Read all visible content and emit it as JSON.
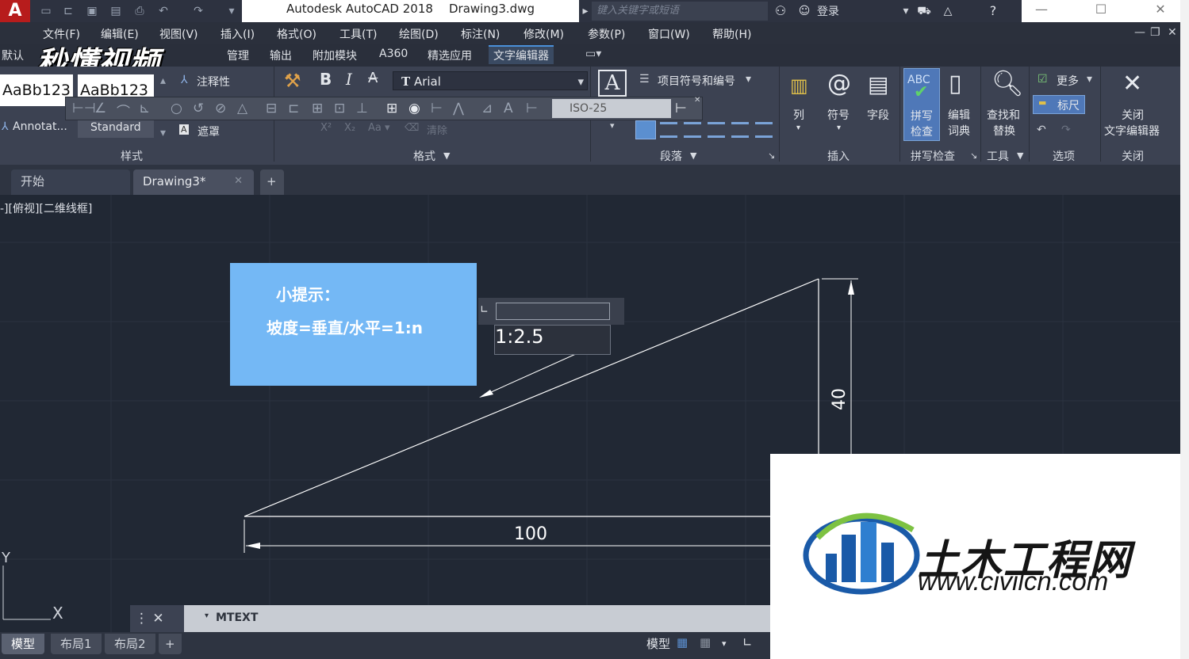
{
  "app": {
    "name": "Autodesk AutoCAD 2018",
    "file": "Drawing3.dwg",
    "logo_letter": "A",
    "search_placeholder": "键入关键字或短语",
    "login": "登录"
  },
  "menu": [
    "文件(F)",
    "编辑(E)",
    "视图(V)",
    "插入(I)",
    "格式(O)",
    "工具(T)",
    "绘图(D)",
    "标注(N)",
    "修改(M)",
    "参数(P)",
    "窗口(W)",
    "帮助(H)"
  ],
  "ribbon_tabs": {
    "first": "默认",
    "items": [
      "管理",
      "输出",
      "附加模块",
      "A360",
      "精选应用",
      "文字编辑器"
    ],
    "active": "文字编辑器"
  },
  "watermark": "秒懂视频",
  "ribbon": {
    "style_sample_1": "AaBb123",
    "style_sample_2": "AaBb123",
    "annotative": "注释性",
    "annot_style": "Annotat...",
    "text_style": "Standard",
    "mask": "遮罩",
    "font": "Arial",
    "bold": "B",
    "italic": "I",
    "strike": "A",
    "bullets": "项目符号和编号",
    "clear": "清除",
    "dimstyle": "ISO-25",
    "column": "列",
    "symbol": "符号",
    "field": "字段",
    "spell_abc": "ABC",
    "spell_1": "拼写",
    "spell_2": "检查",
    "edit_1": "编辑",
    "edit_2": "词典",
    "find_1": "查找和",
    "find_2": "替换",
    "more": "更多",
    "ruler": "标尺",
    "close_1": "关闭",
    "close_2": "文字编辑器",
    "panels": {
      "style": "样式",
      "format": "格式",
      "paragraph": "段落",
      "insert": "插入",
      "spell": "拼写检查",
      "tools": "工具",
      "options": "选项",
      "close": "关闭"
    }
  },
  "file_tabs": {
    "start": "开始",
    "drawing": "Drawing3*",
    "add": "+"
  },
  "view_label": "-][俯视][二维线框]",
  "tip": {
    "title": "小提示：",
    "body": "坡度=垂直/水平=1:n"
  },
  "edit_text": "1:2.5",
  "dims": {
    "horizontal": "100",
    "vertical": "40"
  },
  "command": {
    "text": "MTEXT"
  },
  "layout_tabs": [
    "模型",
    "布局1",
    "布局2"
  ],
  "layout_active": "模型",
  "status_model": "模型",
  "ucs": {
    "x": "X",
    "y": "Y"
  },
  "civil_logo": {
    "name": "土木工程网",
    "url": "www.civilcn.com"
  }
}
